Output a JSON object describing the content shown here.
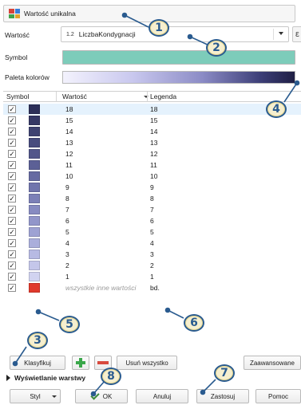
{
  "renderer": {
    "label": "Wartość unikalna",
    "icon": "categorized-renderer-icon"
  },
  "value_row": {
    "label": "Wartość",
    "field_type": "1.2",
    "field": "LiczbaKondygnacji",
    "expr_button": "ε"
  },
  "symbol_row": {
    "label": "Symbol",
    "color": "#7dccba"
  },
  "ramp_row": {
    "label": "Paleta kolorów"
  },
  "table": {
    "headers": {
      "symbol": "Symbol",
      "value": "Wartość",
      "legend": "Legenda"
    },
    "rows": [
      {
        "checked": "✓",
        "color": "#2d2f58",
        "value": "18",
        "legend": "18"
      },
      {
        "checked": "✓",
        "color": "#363865",
        "value": "15",
        "legend": "15"
      },
      {
        "checked": "✓",
        "color": "#3f4271",
        "value": "14",
        "legend": "14"
      },
      {
        "checked": "✓",
        "color": "#484c7e",
        "value": "13",
        "legend": "13"
      },
      {
        "checked": "✓",
        "color": "#52568a",
        "value": "12",
        "legend": "12"
      },
      {
        "checked": "✓",
        "color": "#5c6096",
        "value": "11",
        "legend": "11"
      },
      {
        "checked": "✓",
        "color": "#666aa2",
        "value": "10",
        "legend": "10"
      },
      {
        "checked": "✓",
        "color": "#7175ad",
        "value": "9",
        "legend": "9"
      },
      {
        "checked": "✓",
        "color": "#7c80b7",
        "value": "8",
        "legend": "8"
      },
      {
        "checked": "✓",
        "color": "#878bc1",
        "value": "7",
        "legend": "7"
      },
      {
        "checked": "✓",
        "color": "#9296ca",
        "value": "6",
        "legend": "6"
      },
      {
        "checked": "✓",
        "color": "#9ea2d3",
        "value": "5",
        "legend": "5"
      },
      {
        "checked": "✓",
        "color": "#aaaedb",
        "value": "4",
        "legend": "4"
      },
      {
        "checked": "✓",
        "color": "#b7bae3",
        "value": "3",
        "legend": "3"
      },
      {
        "checked": "✓",
        "color": "#c4c6ea",
        "value": "2",
        "legend": "2"
      },
      {
        "checked": "✓",
        "color": "#d1d3f0",
        "value": "1",
        "legend": "1"
      },
      {
        "checked": "✓",
        "color": "#e0392c",
        "value": "wszystkie inne wartości",
        "legend": "bd.",
        "other": true
      }
    ]
  },
  "buttons": {
    "classify": "Klasyfikuj",
    "remove_all": "Usuń wszystko",
    "advanced": "Zaawansowane",
    "style": "Styl",
    "ok": "OK",
    "cancel": "Anuluj",
    "apply": "Zastosuj",
    "help": "Pomoc"
  },
  "layer_rendering": {
    "label": "Wyświetlanie warstwy"
  },
  "annotations": [
    "1",
    "2",
    "3",
    "4",
    "5",
    "6",
    "7",
    "8"
  ],
  "colors": {
    "annotation_border": "#2a5b8f",
    "annotation_fill": "#f6efcf",
    "selected_row": "#e5f2fd"
  }
}
